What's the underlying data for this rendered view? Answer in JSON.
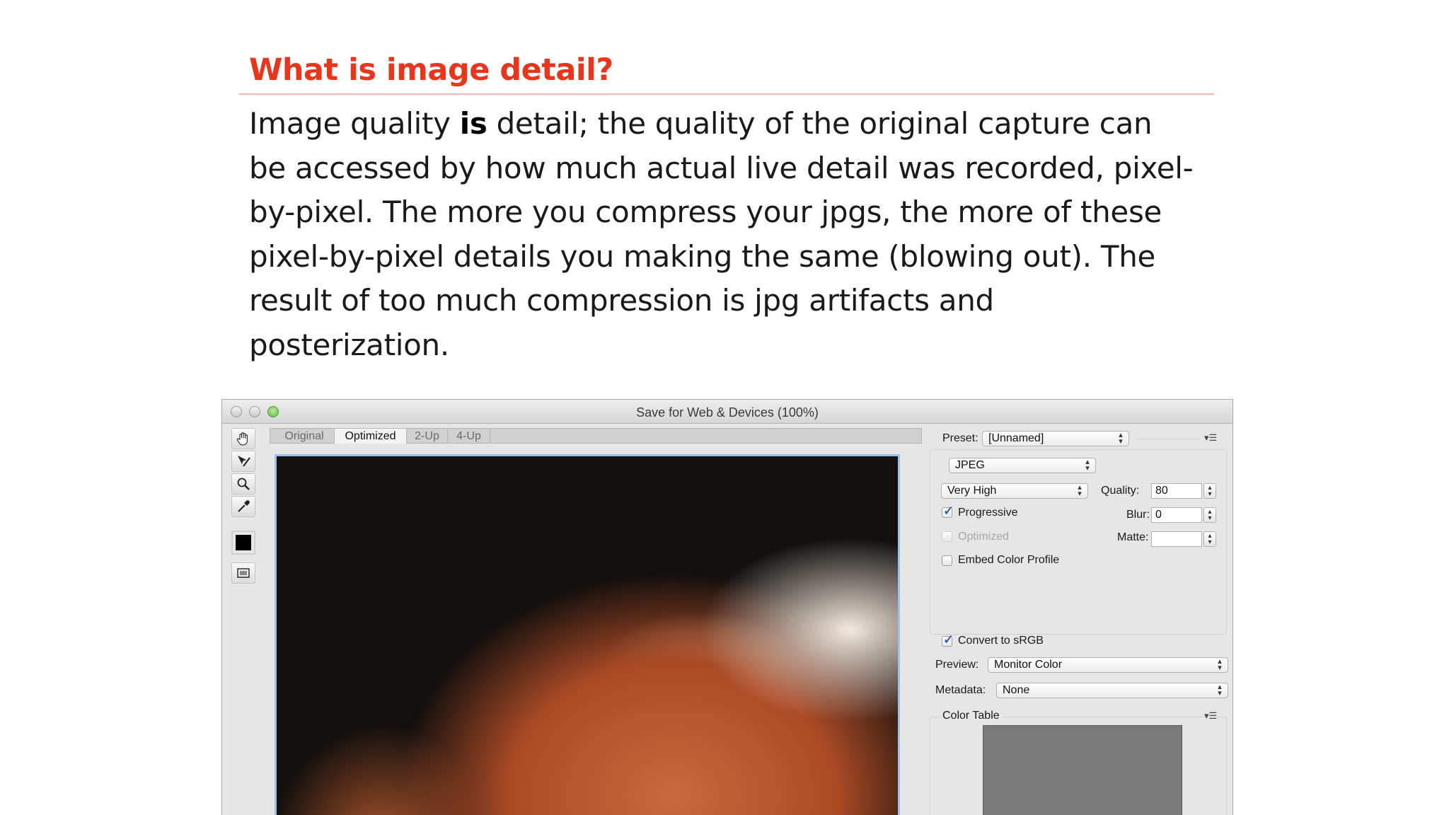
{
  "slide": {
    "title": "What is image detail?",
    "body_before_bold": "Image quality ",
    "body_bold": "is",
    "body_after_bold": " detail; the quality of the original capture can be accessed by how much actual live detail was recorded, pixel-by-pixel. The more you compress your jpgs, the more of these pixel-by-pixel details you making the same (blowing out). The result of too much compression is jpg artifacts and posterization."
  },
  "window": {
    "title": "Save for Web & Devices (100%)"
  },
  "tabs": [
    {
      "label": "Original"
    },
    {
      "label": "Optimized"
    },
    {
      "label": "2-Up"
    },
    {
      "label": "4-Up"
    }
  ],
  "panel": {
    "preset_label": "Preset:",
    "preset_value": "[Unnamed]",
    "format_value": "JPEG",
    "quality_preset_value": "Very High",
    "quality_label": "Quality:",
    "quality_value": "80",
    "blur_label": "Blur:",
    "blur_value": "0",
    "matte_label": "Matte:",
    "progressive_label": "Progressive",
    "optimized_label": "Optimized",
    "embed_label": "Embed Color Profile",
    "convert_label": "Convert to sRGB",
    "preview_label": "Preview:",
    "preview_value": "Monitor Color",
    "metadata_label": "Metadata:",
    "metadata_value": "None",
    "color_table_label": "Color Table"
  },
  "checkboxes": {
    "progressive_checked": true,
    "optimized_checked": false,
    "embed_checked": false,
    "convert_checked": true
  },
  "colors": {
    "title_red": "#e8361c",
    "preview_border": "#9fc0ea"
  }
}
